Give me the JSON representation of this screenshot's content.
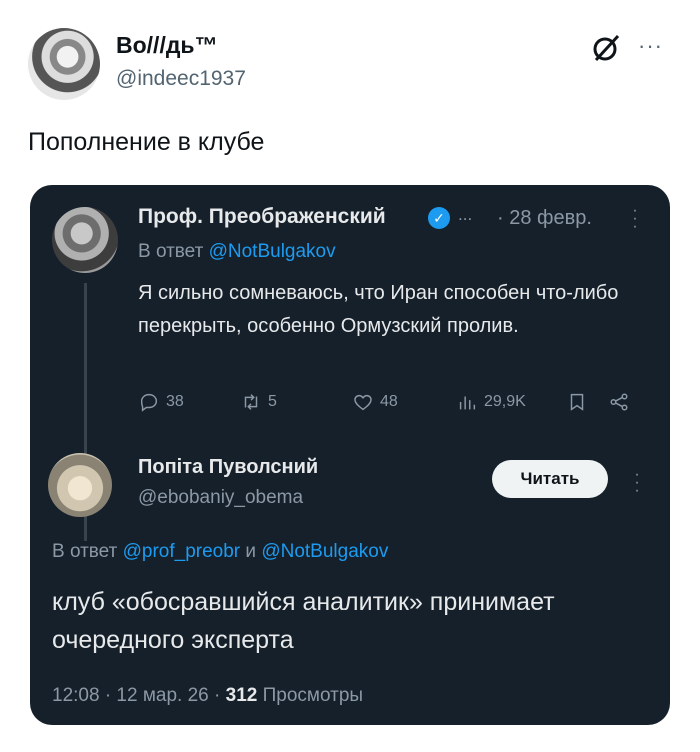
{
  "outer_tweet": {
    "display_name": "Во///дь™",
    "handle": "@indeec1937",
    "text": "Пополнение в клубе",
    "more_label": "···"
  },
  "embedded": {
    "quoted": {
      "display_name": "Проф. Преображенский",
      "verified_mark": "✓",
      "dots": "...",
      "date": "· 28 февр.",
      "reply_prefix": "В ответ",
      "reply_mention": "@NotBulgakov",
      "text": "Я сильно сомневаюсь, что Иран способен что-либо перекрыть, особенно Ормузский пролив.",
      "actions": {
        "replies": "38",
        "reposts": "5",
        "likes": "48",
        "views": "29,9K"
      }
    },
    "reply": {
      "display_name": "Попіта Пуволсний",
      "handle": "@ebobaniy_obema",
      "follow_label": "Читать",
      "reply_prefix": "В ответ",
      "reply_mention_1": "@prof_preobr",
      "reply_and": "и",
      "reply_mention_2": "@NotBulgakov",
      "text": "клуб «обосравшийся аналитик» принимает очередного эксперта",
      "time": "12:08 · 12 мар. 26 ·",
      "views_count": "312",
      "views_label": "Просмотры"
    }
  },
  "colors": {
    "card_bg": "#15202b",
    "accent": "#1d9bf0",
    "muted": "#8b98a5"
  }
}
